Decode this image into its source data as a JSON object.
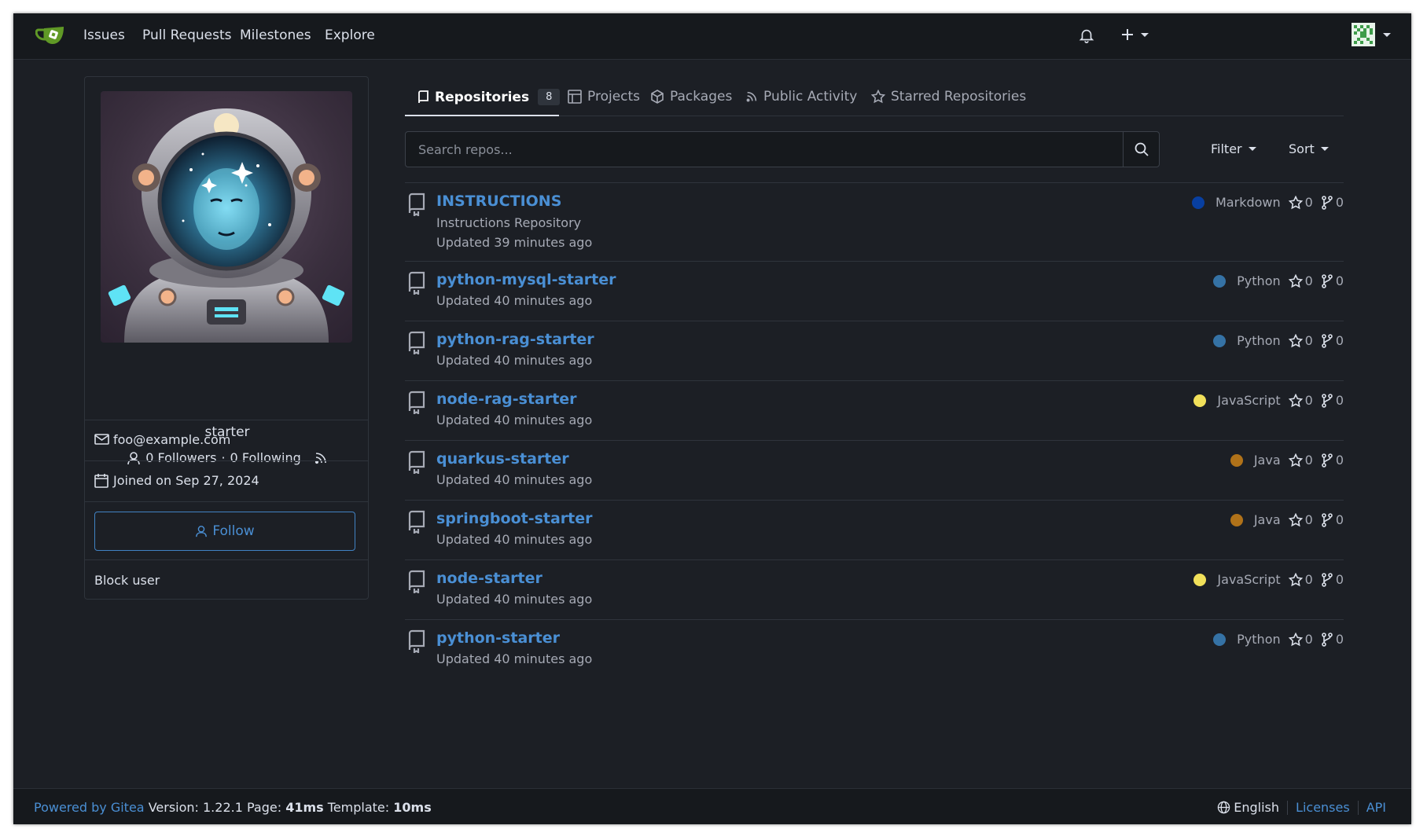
{
  "nav": {
    "items": [
      "Issues",
      "Pull Requests",
      "Milestones",
      "Explore"
    ]
  },
  "profile": {
    "username": "starter",
    "followers": "0 Followers",
    "following": "0 Following",
    "stats_separator": "·",
    "email": "foo@example.com",
    "joined": "Joined on Sep 27, 2024",
    "follow_label": "Follow",
    "block_label": "Block user"
  },
  "tabs": [
    {
      "label": "Repositories",
      "count": "8",
      "icon": "repo-icon"
    },
    {
      "label": "Projects",
      "icon": "project-icon"
    },
    {
      "label": "Packages",
      "icon": "package-icon"
    },
    {
      "label": "Public Activity",
      "icon": "rss-icon"
    },
    {
      "label": "Starred Repositories",
      "icon": "star-icon"
    }
  ],
  "search": {
    "placeholder": "Search repos...",
    "filter_label": "Filter",
    "sort_label": "Sort"
  },
  "repos": [
    {
      "name": "INSTRUCTIONS",
      "description": "Instructions Repository",
      "updated": "Updated 39 minutes ago",
      "language": "Markdown",
      "lang_color": "#083fa1",
      "stars": "0",
      "forks": "0"
    },
    {
      "name": "python-mysql-starter",
      "description": "",
      "updated": "Updated 40 minutes ago",
      "language": "Python",
      "lang_color": "#3572a5",
      "stars": "0",
      "forks": "0"
    },
    {
      "name": "python-rag-starter",
      "description": "",
      "updated": "Updated 40 minutes ago",
      "language": "Python",
      "lang_color": "#3572a5",
      "stars": "0",
      "forks": "0"
    },
    {
      "name": "node-rag-starter",
      "description": "",
      "updated": "Updated 40 minutes ago",
      "language": "JavaScript",
      "lang_color": "#f1e05a",
      "stars": "0",
      "forks": "0"
    },
    {
      "name": "quarkus-starter",
      "description": "",
      "updated": "Updated 40 minutes ago",
      "language": "Java",
      "lang_color": "#b07219",
      "stars": "0",
      "forks": "0"
    },
    {
      "name": "springboot-starter",
      "description": "",
      "updated": "Updated 40 minutes ago",
      "language": "Java",
      "lang_color": "#b07219",
      "stars": "0",
      "forks": "0"
    },
    {
      "name": "node-starter",
      "description": "",
      "updated": "Updated 40 minutes ago",
      "language": "JavaScript",
      "lang_color": "#f1e05a",
      "stars": "0",
      "forks": "0"
    },
    {
      "name": "python-starter",
      "description": "",
      "updated": "Updated 40 minutes ago",
      "language": "Python",
      "lang_color": "#3572a5",
      "stars": "0",
      "forks": "0"
    }
  ],
  "footer": {
    "powered_by": "Powered by Gitea",
    "version": "Version: 1.22.1",
    "page_label": "Page:",
    "page_time": "41ms",
    "template_label": "Template:",
    "template_time": "10ms",
    "language": "English",
    "licenses": "Licenses",
    "api": "API"
  },
  "colors": {
    "accent": "#4a8fd4",
    "background": "#1c1f25",
    "navbar": "#16191d"
  }
}
